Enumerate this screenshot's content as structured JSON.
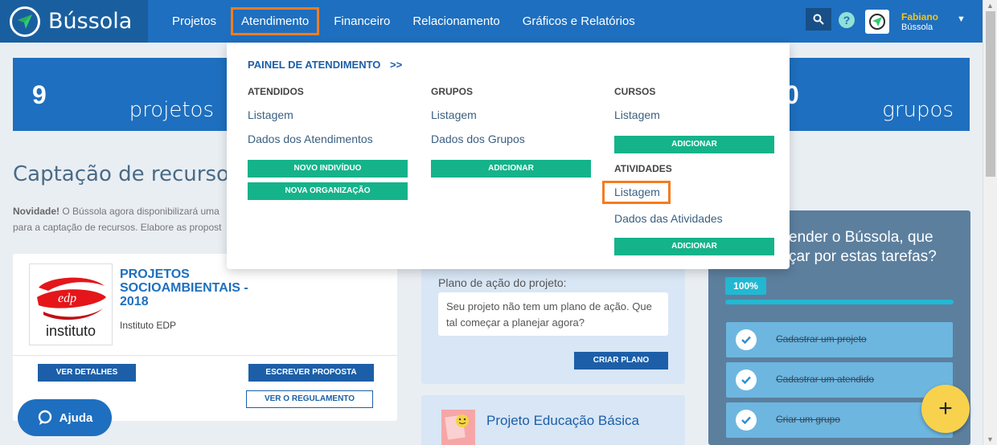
{
  "header": {
    "brand": "Bússola",
    "nav": [
      "Projetos",
      "Atendimento",
      "Financeiro",
      "Relacionamento",
      "Gráficos e Relatórios"
    ],
    "active_nav": "Atendimento",
    "help_label": "?",
    "user": {
      "name": "Fabiano",
      "org": "Bússola"
    }
  },
  "stats": {
    "left": {
      "value": "9",
      "label": "projetos"
    },
    "right": {
      "value": "0",
      "label": "grupos"
    }
  },
  "captacao": {
    "title": "Captação de recursos",
    "novidade": "Novidade!",
    "text1": " O Bússola agora disponibilizará uma",
    "text2": "para a captação de recursos. Elabore as propost"
  },
  "project_card": {
    "logo_text": "instituto",
    "logo_brand": "edp",
    "title": "PROJETOS SOCIOAMBIENTAIS - 2018",
    "org": "Instituto EDP",
    "btn_details": "VER DETALHES",
    "btn_write": "ESCREVER PROPOSTA",
    "btn_rules": "VER O REGULAMENTO"
  },
  "ajuda": "Ajuda",
  "plan_card": {
    "label": "Plano de ação do projeto:",
    "text": "Seu projeto não tem um plano de ação. Que tal começar a planejar agora?",
    "btn": "CRIAR PLANO"
  },
  "project_card2": {
    "title": "Projeto Educação Básica"
  },
  "onboarding": {
    "title": "ender o Bússola, que\nçar por estas tarefas?",
    "progress_label": "100%",
    "progress": 1.0,
    "tasks": [
      "Cadastrar um projeto",
      "Cadastrar um atendido",
      "Criar um grupo"
    ]
  },
  "fab": "+",
  "dropdown": {
    "heading": "PAINEL DE ATENDIMENTO",
    "heading_arrow": ">>",
    "atendidos": {
      "title": "ATENDIDOS",
      "links": [
        "Listagem",
        "Dados dos Atendimentos"
      ],
      "btns": [
        "NOVO INDIVÍDUO",
        "NOVA ORGANIZAÇÃO"
      ]
    },
    "grupos": {
      "title": "GRUPOS",
      "links": [
        "Listagem",
        "Dados dos Grupos"
      ],
      "btn": "ADICIONAR"
    },
    "cursos": {
      "title": "CURSOS",
      "links": [
        "Listagem"
      ],
      "btn": "ADICIONAR"
    },
    "atividades": {
      "title": "ATIVIDADES",
      "links": [
        "Listagem",
        "Dados das Atividades"
      ],
      "btn": "ADICIONAR"
    }
  }
}
